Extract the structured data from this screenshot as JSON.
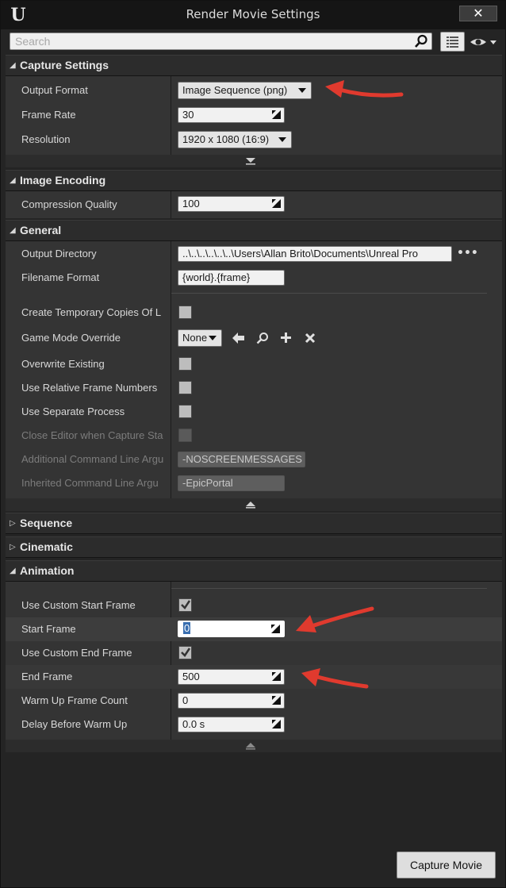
{
  "window": {
    "title": "Render Movie Settings",
    "close_glyph": "✕",
    "logo": "U"
  },
  "search": {
    "placeholder": "Search"
  },
  "categories": {
    "capture": "Capture Settings",
    "encoding": "Image Encoding",
    "general": "General",
    "sequence": "Sequence",
    "cinematic": "Cinematic",
    "animation": "Animation"
  },
  "capture": {
    "output_format_label": "Output Format",
    "output_format_value": "Image Sequence (png)",
    "frame_rate_label": "Frame Rate",
    "frame_rate_value": "30",
    "resolution_label": "Resolution",
    "resolution_value": "1920 x 1080 (16:9)"
  },
  "encoding": {
    "quality_label": "Compression Quality",
    "quality_value": "100"
  },
  "general": {
    "output_dir_label": "Output Directory",
    "output_dir_value": "..\\..\\..\\..\\..\\..\\Users\\Allan Brito\\Documents\\Unreal Pro",
    "more": "•••",
    "filename_label": "Filename Format",
    "filename_value": "{world}.{frame}",
    "temp_copies_label": "Create Temporary Copies Of L",
    "game_mode_label": "Game Mode Override",
    "game_mode_value": "None",
    "overwrite_label": "Overwrite Existing",
    "relative_frames_label": "Use Relative Frame Numbers",
    "separate_process_label": "Use Separate Process",
    "close_editor_label": "Close Editor when Capture Sta",
    "additional_cmd_label": "Additional Command Line Argu",
    "additional_cmd_value": "-NOSCREENMESSAGES",
    "inherited_cmd_label": "Inherited Command Line Argu",
    "inherited_cmd_value": "-EpicPortal"
  },
  "animation": {
    "custom_start_label": "Use Custom Start Frame",
    "start_frame_label": "Start Frame",
    "start_frame_value": "0",
    "custom_end_label": "Use Custom End Frame",
    "end_frame_label": "End Frame",
    "end_frame_value": "500",
    "warmup_count_label": "Warm Up Frame Count",
    "warmup_count_value": "0",
    "delay_label": "Delay Before Warm Up",
    "delay_value": "0.0 s"
  },
  "footer": {
    "capture_button": "Capture Movie"
  },
  "colors": {
    "annotation_arrow": "#e03a2e",
    "background": "#242424",
    "panel": "#343434"
  },
  "icons": [
    "unreal-logo-icon",
    "search-icon",
    "list-view-icon",
    "eye-icon",
    "expand-icon",
    "collapse-icon",
    "browse-arrow-icon",
    "magnifier-icon",
    "plus-icon",
    "clear-icon",
    "checkmark-icon",
    "spin-handle-icon"
  ]
}
